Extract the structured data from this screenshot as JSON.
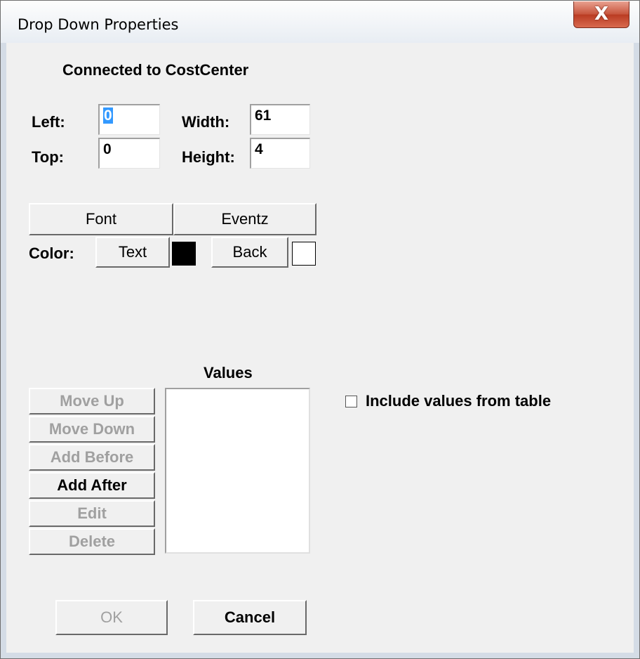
{
  "window": {
    "title": "Drop Down Properties",
    "close_glyph": "X"
  },
  "header": {
    "connected": "Connected to CostCenter"
  },
  "position": {
    "left_label": "Left:",
    "left_value": "0",
    "top_label": "Top:",
    "top_value": "0",
    "width_label": "Width:",
    "width_value": "61",
    "height_label": "Height:",
    "height_value": "4"
  },
  "buttons": {
    "font": "Font",
    "events": "Eventz"
  },
  "color": {
    "label": "Color:",
    "text_button": "Text",
    "back_button": "Back",
    "text_swatch": "#000000",
    "back_swatch": "#ffffff"
  },
  "values": {
    "label": "Values",
    "list_items": [],
    "move_up": "Move Up",
    "move_down": "Move Down",
    "add_before": "Add Before",
    "add_after": "Add After",
    "edit": "Edit",
    "delete": "Delete",
    "include_label": "Include values from table",
    "include_checked": false
  },
  "footer": {
    "ok": "OK",
    "cancel": "Cancel"
  },
  "colors": {
    "disabled_text": "#a0a0a0",
    "selection": "#3399ff",
    "face": "#f0f0f0"
  }
}
